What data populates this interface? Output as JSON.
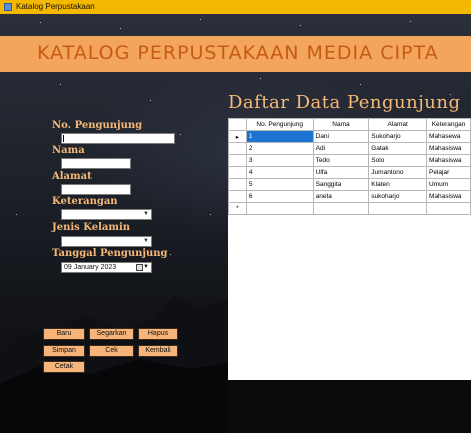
{
  "window": {
    "title": "Katalog Perpustakaan"
  },
  "header": {
    "title": "KATALOG PERPUSTAKAAN MEDIA CIPTA"
  },
  "form": {
    "labels": {
      "no": "No. Pengunjung",
      "nama": "Nama",
      "alamat": "Alamat",
      "keterangan": "Keterangan",
      "jenis_kelamin": "Jenis Kelamin",
      "tanggal": "Tanggal Pengunjung"
    },
    "values": {
      "no": "",
      "nama": "",
      "alamat": "",
      "keterangan": "",
      "jenis_kelamin": "",
      "tanggal": "09  January   2023"
    }
  },
  "buttons": {
    "baru": "Baru",
    "segarkan": "Segarkan",
    "hapus": "Hapus",
    "simpan": "Simpan",
    "cek": "Cek",
    "kembali": "Kembali",
    "cetak": "Cetak"
  },
  "grid": {
    "title": "Daftar Data Pengunjung",
    "columns": [
      "No. Pengunjung",
      "Nama",
      "Alamat",
      "Keterangan"
    ],
    "rows": [
      [
        "1",
        "Dani",
        "Sukoharjo",
        "Mahasewa"
      ],
      [
        "2",
        "Adi",
        "Gatak",
        "Mahasiswa"
      ],
      [
        "3",
        "Tedo",
        "Solo",
        "Mahasiswa"
      ],
      [
        "4",
        "Ulfa",
        "Jumantono",
        "Pelajar"
      ],
      [
        "5",
        "Sanggita",
        "Klaten",
        "Umum"
      ],
      [
        "6",
        "aneta",
        "sukoharjo",
        "Mahasiswa"
      ]
    ],
    "current_row_marker": "▸",
    "new_row_marker": "*"
  },
  "icons": {
    "app": "app-icon",
    "dropdown": "chevron-down-icon",
    "calendar": "calendar-icon"
  }
}
